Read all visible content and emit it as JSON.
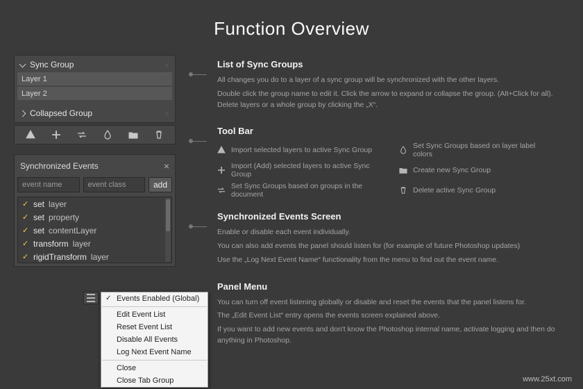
{
  "title": "Function Overview",
  "syncGroups": {
    "expanded": {
      "name": "Sync Group",
      "children": [
        "Layer 1",
        "Layer 2"
      ]
    },
    "collapsed": {
      "name": "Collapsed Group"
    }
  },
  "toolbar": {
    "items": [
      {
        "name": "import-triangle",
        "label": "Import selected layers to active Sync Group"
      },
      {
        "name": "add-plus",
        "label": "Import (Add) selected layers to active Sync Group"
      },
      {
        "name": "swap-arrows",
        "label": "Set Sync Groups based on groups in the document"
      },
      {
        "name": "drop-color",
        "label": "Set Sync Groups based on layer label colors"
      },
      {
        "name": "folder",
        "label": "Create new Sync Group"
      },
      {
        "name": "trash",
        "label": "Delete active Sync Group"
      }
    ]
  },
  "eventsPanel": {
    "title": "Synchronized Events",
    "filters": {
      "name_ph": "event name",
      "class_ph": "event class",
      "add": "add"
    },
    "events": [
      {
        "a": "set",
        "b": "layer"
      },
      {
        "a": "set",
        "b": "property"
      },
      {
        "a": "set",
        "b": "contentLayer"
      },
      {
        "a": "transform",
        "b": "layer"
      },
      {
        "a": "rigidTransform",
        "b": "layer"
      }
    ]
  },
  "menu": {
    "items": [
      {
        "label": "Events Enabled (Global)",
        "check": true
      },
      {
        "sep": true
      },
      {
        "label": "Edit Event List"
      },
      {
        "label": "Reset Event List"
      },
      {
        "label": "Disable All Events"
      },
      {
        "label": "Log Next Event Name"
      },
      {
        "sep": true
      },
      {
        "label": "Close"
      },
      {
        "label": "Close Tab Group"
      }
    ]
  },
  "sections": {
    "sync": {
      "h": "List of Sync Groups",
      "p1": "All changes you do to a layer of a sync group will be synchronized with the other layers.",
      "p2": "Double click the group name to edit it. Click the arrow to expand or collapse the group. (Alt+Click for all). Delete layers or a whole group by clicking the „X“."
    },
    "tool": {
      "h": "Tool Bar"
    },
    "events": {
      "h": "Synchronized Events Screen",
      "p1": "Enable or disable each event individually.",
      "p2": "You can also add events the panel should listen for (for example of future Photoshop updates)",
      "p3": "Use the „Log Next Event Name“ functionality from the menu to find out the event name."
    },
    "panelmenu": {
      "h": "Panel Menu",
      "p1": "You can turn off event listening globally or disable and reset the events that the panel listens for.",
      "p2": "The „Edit Event List“ entry opens the events screen explained above.",
      "p3": "If you want to add new events and don't know the Photoshop internal name, activate logging and then do anything in Photoshop."
    }
  },
  "watermark": "www.25xt.com"
}
